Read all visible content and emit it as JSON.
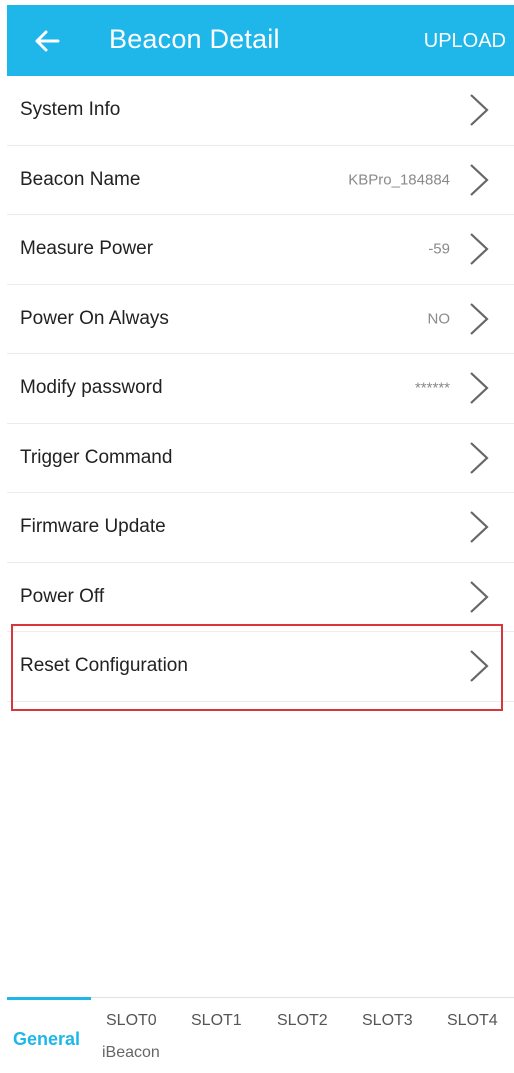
{
  "header": {
    "title": "Beacon Detail",
    "upload_label": "UPLOAD",
    "back_icon": "arrow-left-icon"
  },
  "rows": [
    {
      "label": "System Info",
      "value": ""
    },
    {
      "label": "Beacon Name",
      "value": "KBPro_184884"
    },
    {
      "label": "Measure Power",
      "value": "-59"
    },
    {
      "label": "Power On Always",
      "value": "NO"
    },
    {
      "label": "Modify password",
      "value": "******"
    },
    {
      "label": "Trigger Command",
      "value": ""
    },
    {
      "label": "Firmware Update",
      "value": ""
    },
    {
      "label": "Power Off",
      "value": ""
    },
    {
      "label": "Reset Configuration",
      "value": ""
    }
  ],
  "tabs": {
    "general": "General",
    "slot0": "SLOT0",
    "slot1": "SLOT1",
    "slot2": "SLOT2",
    "slot3": "SLOT3",
    "slot4": "SLOT4",
    "slot0_sub": "iBeacon"
  },
  "colors": {
    "accent": "#1fb6ea",
    "highlight": "#d8363d"
  }
}
